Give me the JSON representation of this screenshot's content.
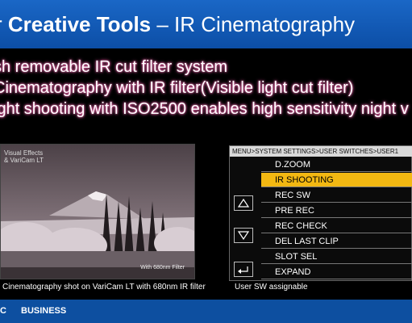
{
  "title": {
    "prefix": "r ",
    "bold": "Creative Tools",
    "rest": " – IR Cinematography"
  },
  "bullets": [
    "sh removable IR cut filter system",
    "Cinematography with IR filter(Visible light cut filter)",
    "ight shooting with ISO2500 enables high sensitivity night v"
  ],
  "photo": {
    "overlay_top_1": "Visual Effects",
    "overlay_top_2": "& VariCam LT",
    "overlay_bottom": "With 680nm Filter"
  },
  "left_caption": "Cinematography shot on VariCam LT with 680nm IR filter",
  "menu": {
    "header": "MENU>SYSTEM SETTINGS>USER SWITCHES>USER1",
    "items": [
      {
        "label": "D.ZOOM",
        "selected": false
      },
      {
        "label": "IR SHOOTING",
        "selected": true
      },
      {
        "label": "REC SW",
        "selected": false
      },
      {
        "label": "PRE REC",
        "selected": false
      },
      {
        "label": "REC CHECK",
        "selected": false
      },
      {
        "label": "DEL LAST CLIP",
        "selected": false
      },
      {
        "label": "SLOT SEL",
        "selected": false
      },
      {
        "label": "EXPAND",
        "selected": false
      }
    ],
    "icons": [
      "up-triangle-icon",
      "down-triangle-icon",
      "return-arrow-icon"
    ],
    "highlight_color": "#f3b812"
  },
  "right_caption": "User SW assignable",
  "footer": {
    "brand": "C",
    "label": "BUSINESS",
    "color": "#0d4fa0"
  }
}
